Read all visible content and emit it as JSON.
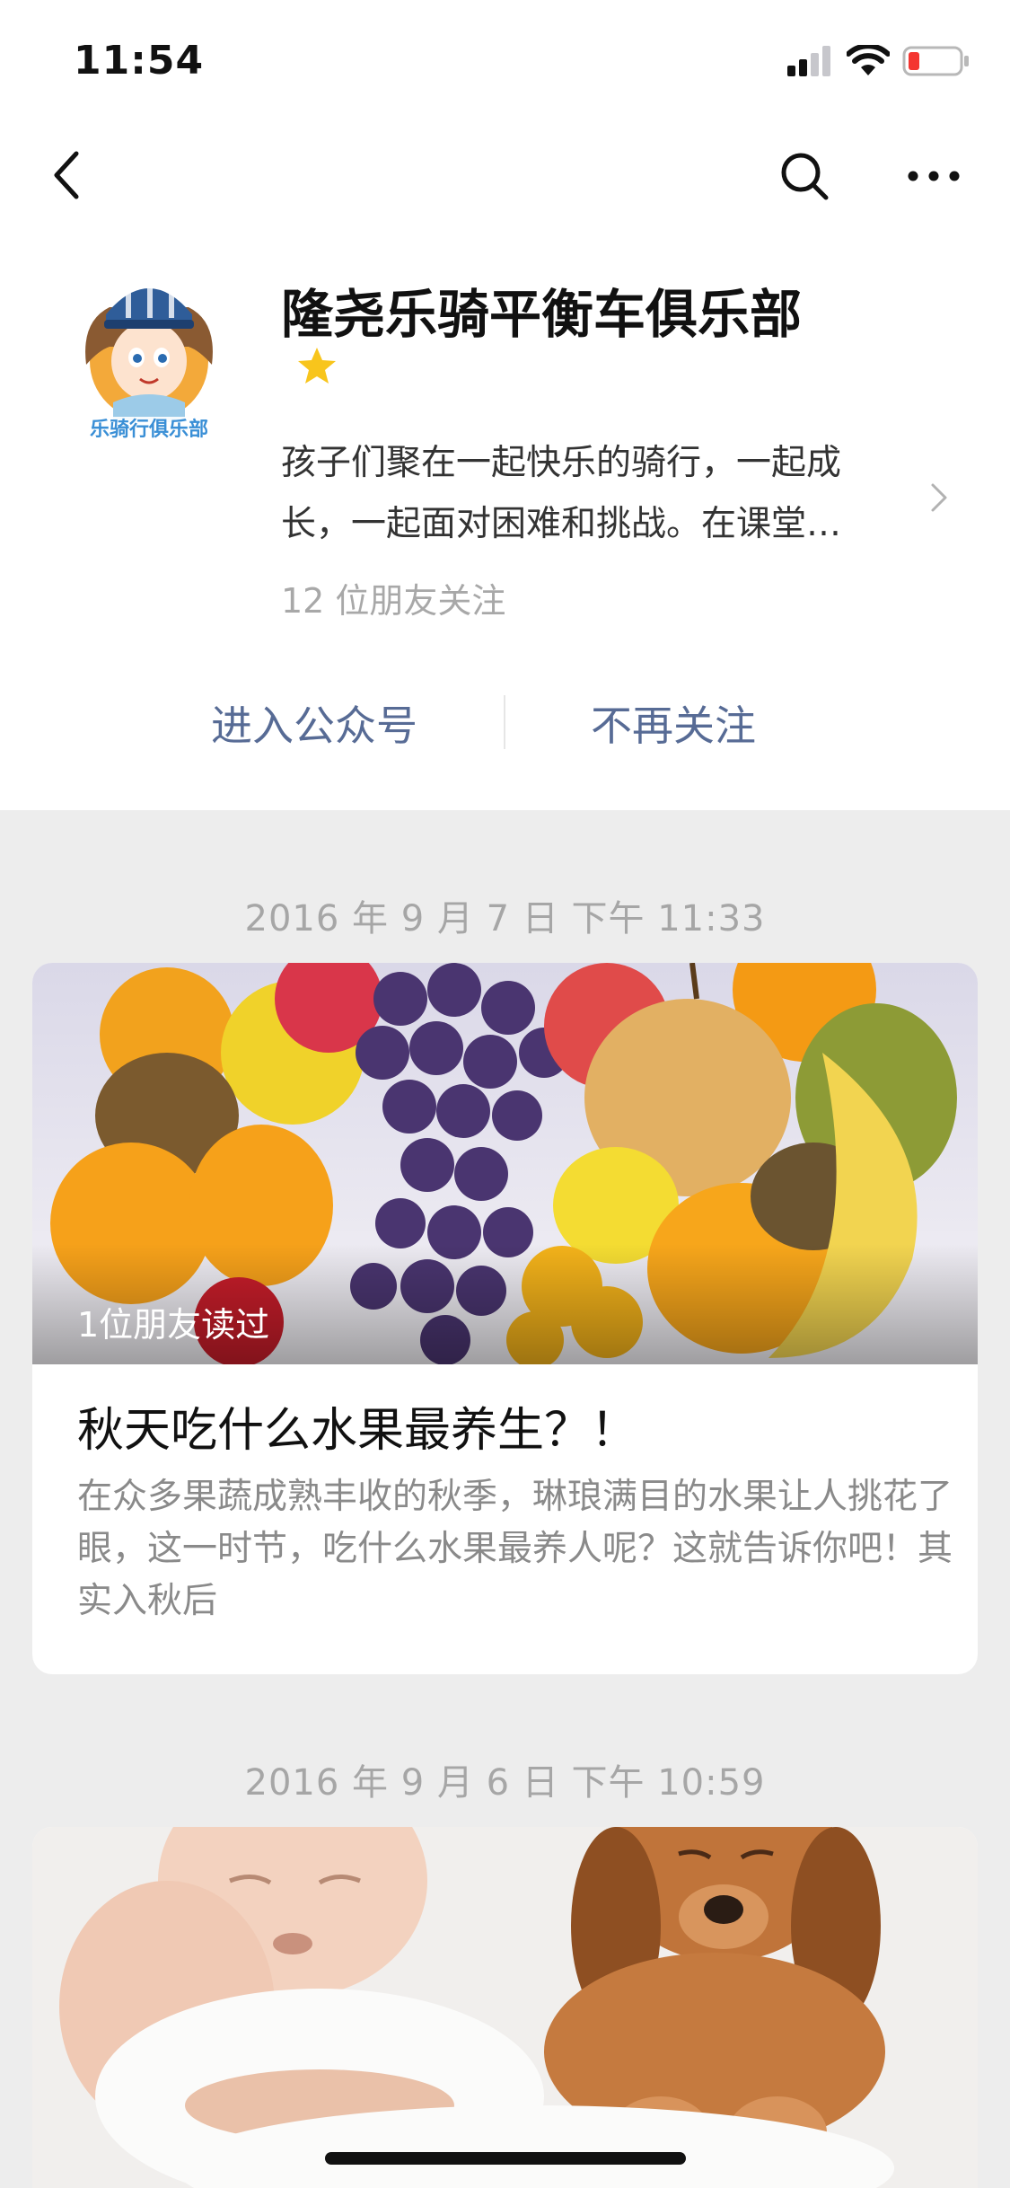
{
  "status_bar": {
    "time": "11:54"
  },
  "profile": {
    "name": "隆尧乐骑平衡车俱乐部",
    "description": "孩子们聚在一起快乐的骑行，一起成长，一起面对困难和挑战。在课堂…",
    "friends_following": "12 位朋友关注",
    "avatar_banner": "乐骑行俱乐部"
  },
  "actions": {
    "enter_label": "进入公众号",
    "unfollow_label": "不再关注"
  },
  "colors": {
    "link": "#576b95",
    "star": "#f8c51c",
    "battery_low": "#f43530"
  },
  "articles": [
    {
      "timestamp": "2016 年 9 月 7 日 下午 11:33",
      "read_badge": "1位朋友读过",
      "title": "秋天吃什么水果最养生？！",
      "digest": "在众多果蔬成熟丰收的秋季，琳琅满目的水果让人挑花了眼，这一时节，吃什么水果最养人呢？这就告诉你吧！其实入秋后"
    },
    {
      "timestamp": "2016 年 9 月 6 日 下午 10:59"
    }
  ]
}
